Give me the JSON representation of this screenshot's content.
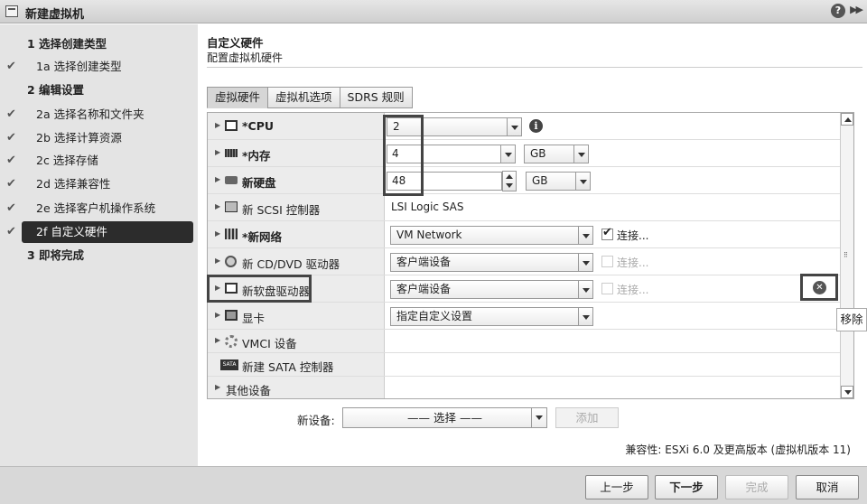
{
  "window": {
    "title": "新建虚拟机",
    "help_icon": "help-icon",
    "expand_icon": "expand-icon"
  },
  "steps": [
    {
      "label": "1 选择创建类型",
      "type": "main",
      "checked": false
    },
    {
      "label": "1a 选择创建类型",
      "type": "sub",
      "checked": true
    },
    {
      "label": "2 编辑设置",
      "type": "main",
      "checked": false
    },
    {
      "label": "2a 选择名称和文件夹",
      "type": "sub",
      "checked": true
    },
    {
      "label": "2b 选择计算资源",
      "type": "sub",
      "checked": true
    },
    {
      "label": "2c 选择存储",
      "type": "sub",
      "checked": true
    },
    {
      "label": "2d 选择兼容性",
      "type": "sub",
      "checked": true
    },
    {
      "label": "2e 选择客户机操作系统",
      "type": "sub",
      "checked": true
    },
    {
      "label": "2f 自定义硬件",
      "type": "sub",
      "checked": true,
      "active": true
    },
    {
      "label": "3 即将完成",
      "type": "main",
      "checked": false
    }
  ],
  "header": {
    "title": "自定义硬件",
    "subtitle": "配置虚拟机硬件"
  },
  "tabs": [
    "虚拟硬件",
    "虚拟机选项",
    "SDRS 规则"
  ],
  "hardware": {
    "cpu": {
      "label": "*CPU",
      "value": "2"
    },
    "memory": {
      "label": "*内存",
      "value": "4",
      "unit": "GB"
    },
    "disk": {
      "label": "新硬盘",
      "value": "48",
      "unit": "GB"
    },
    "scsi": {
      "label": "新 SCSI 控制器",
      "value": "LSI Logic SAS"
    },
    "network": {
      "label": "*新网络",
      "value": "VM Network",
      "connect": "连接..."
    },
    "cdrom": {
      "label": "新 CD/DVD 驱动器",
      "value": "客户端设备",
      "connect": "连接..."
    },
    "floppy": {
      "label": "新软盘驱动器",
      "value": "客户端设备",
      "connect": "连接..."
    },
    "video": {
      "label": "显卡",
      "value": "指定自定义设置"
    },
    "vmci": {
      "label": "VMCI 设备"
    },
    "sata": {
      "label": "新建 SATA 控制器",
      "icon_text": "SATA"
    },
    "other": {
      "label": "其他设备"
    }
  },
  "remove_tooltip": "移除",
  "new_device": {
    "label": "新设备:",
    "select": "—— 选择 ——",
    "add": "添加"
  },
  "compatibility": "兼容性: ESXi 6.0 及更高版本 (虚拟机版本 11)",
  "footer": {
    "back": "上一步",
    "next": "下一步",
    "finish": "完成",
    "cancel": "取消"
  }
}
